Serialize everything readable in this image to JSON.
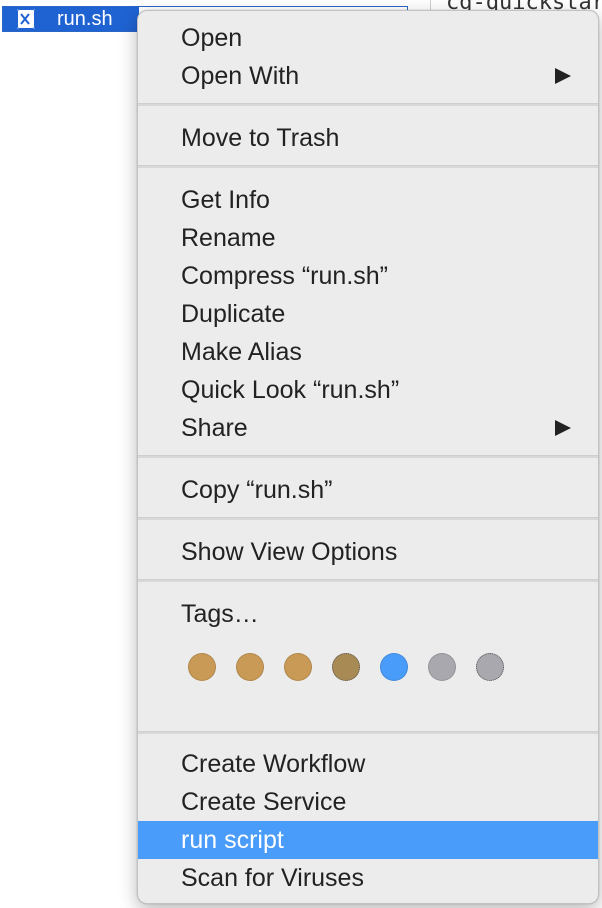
{
  "finder": {
    "file_name": "run.sh",
    "neighbor_text": "cg-quickstar"
  },
  "menu": {
    "items": [
      {
        "label": "Open"
      },
      {
        "label": "Open With",
        "submenu": true
      },
      {
        "label": "Move to Trash"
      },
      {
        "label": "Get Info"
      },
      {
        "label": "Rename"
      },
      {
        "label": "Compress “run.sh”"
      },
      {
        "label": "Duplicate"
      },
      {
        "label": "Make Alias"
      },
      {
        "label": "Quick Look “run.sh”"
      },
      {
        "label": "Share",
        "submenu": true
      },
      {
        "label": "Copy “run.sh”"
      },
      {
        "label": "Show View Options"
      },
      {
        "label": "Tags…"
      },
      {
        "label": "Create Workflow"
      },
      {
        "label": "Create Service"
      },
      {
        "label": "run script",
        "highlighted": true
      },
      {
        "label": "Scan for Viruses"
      }
    ],
    "tag_colors": [
      {
        "name": "tag-1",
        "color": "#c99a55"
      },
      {
        "name": "tag-2",
        "color": "#c99a55"
      },
      {
        "name": "tag-3",
        "color": "#c99a55"
      },
      {
        "name": "tag-4",
        "color": "#a88a54",
        "dotted": true
      },
      {
        "name": "tag-5",
        "color": "#4a9cfa"
      },
      {
        "name": "tag-6",
        "color": "#a8a8ae"
      },
      {
        "name": "tag-7",
        "color": "#a8a8ae",
        "dotted": true
      }
    ],
    "highlight_color": "#4a9cfa"
  }
}
